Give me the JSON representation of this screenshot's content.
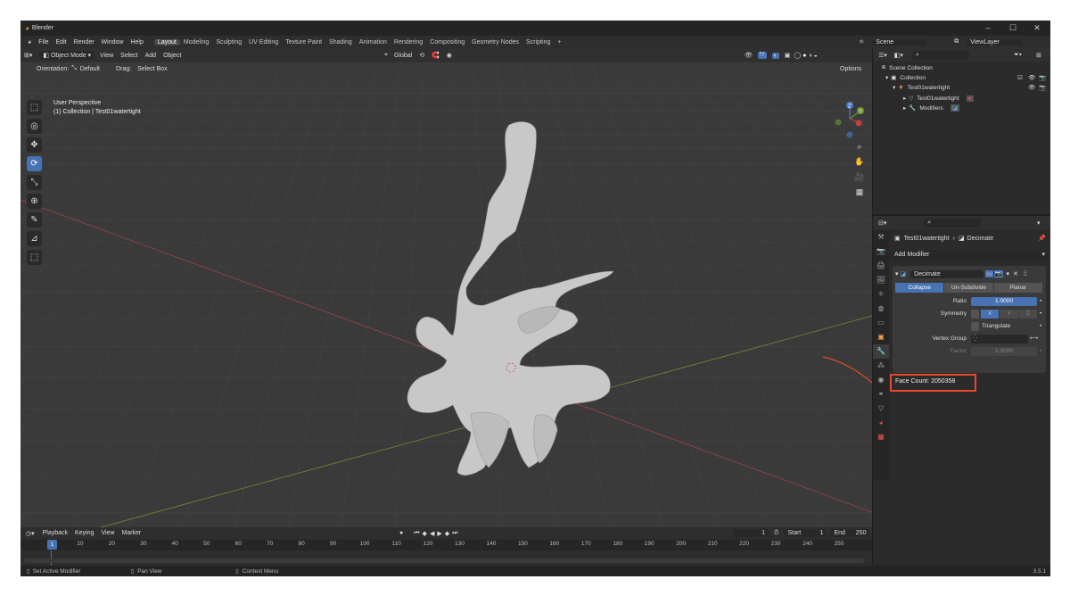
{
  "app": {
    "title": "Blender",
    "version": "3.5.1"
  },
  "menu": [
    "File",
    "Edit",
    "Render",
    "Window",
    "Help"
  ],
  "workspaces": [
    {
      "label": "Layout",
      "active": true
    },
    {
      "label": "Modeling"
    },
    {
      "label": "Sculpting"
    },
    {
      "label": "UV Editing"
    },
    {
      "label": "Texture Paint"
    },
    {
      "label": "Shading"
    },
    {
      "label": "Animation"
    },
    {
      "label": "Rendering"
    },
    {
      "label": "Compositing"
    },
    {
      "label": "Geometry Nodes"
    },
    {
      "label": "Scripting"
    }
  ],
  "add_workspace": "+",
  "scene": {
    "label": "Scene",
    "view_layer": "ViewLayer"
  },
  "viewport": {
    "mode": "Object Mode",
    "menus": [
      "View",
      "Select",
      "Add",
      "Object"
    ],
    "transform": "Global",
    "orientation_label": "Orientation:",
    "orientation_value": "Default",
    "drag_label": "Drag:",
    "drag_value": "Select Box",
    "options": "Options",
    "perspective": "User Perspective",
    "collection_info": "(1) Collection | Test01watertight",
    "colors": {
      "bg": "#3a3a3a",
      "grid": "#444444",
      "x_axis": "#b04848",
      "y_axis": "#7a9a3a",
      "mesh": "#c9c9c9"
    }
  },
  "tools": [
    {
      "icon": "select-box-icon",
      "glyph": "⬚",
      "active": false
    },
    {
      "icon": "cursor-icon",
      "glyph": "◎",
      "active": false
    },
    {
      "icon": "move-icon",
      "glyph": "✥",
      "active": false
    },
    {
      "icon": "rotate-icon",
      "glyph": "⟳",
      "active": true
    },
    {
      "icon": "scale-icon",
      "glyph": "⤡",
      "active": false
    },
    {
      "icon": "transform-icon",
      "glyph": "⊕",
      "active": false
    },
    {
      "icon": "annotate-icon",
      "glyph": "✎",
      "active": false
    },
    {
      "icon": "measure-icon",
      "glyph": "📐",
      "active": false
    },
    {
      "icon": "add-cube-icon",
      "glyph": "⬛",
      "active": false
    }
  ],
  "gizmo": {
    "z": "Z",
    "y": "Y"
  },
  "timeline": {
    "menus": [
      "Playback",
      "Keying",
      "View",
      "Marker"
    ],
    "current_frame": "1",
    "start_label": "Start",
    "start": "1",
    "end_label": "End",
    "end": "250",
    "ticks": [
      "1",
      "10",
      "20",
      "30",
      "40",
      "50",
      "60",
      "70",
      "80",
      "90",
      "100",
      "110",
      "120",
      "130",
      "140",
      "150",
      "160",
      "170",
      "180",
      "190",
      "200",
      "210",
      "220",
      "230",
      "240",
      "250"
    ]
  },
  "status": {
    "left": "Set Active Modifier",
    "middle": "Pan View",
    "right": "Context Menu"
  },
  "outliner": {
    "scene_collection": "Scene Collection",
    "collection": "Collection",
    "object": "Test01watertight",
    "mesh": "Test01watertight",
    "modifiers": "Modifiers"
  },
  "properties": {
    "object": "Test01watertight",
    "modifier_path": "Decimate",
    "add_modifier": "Add Modifier",
    "modifier_name": "Decimate",
    "modes": [
      "Collapse",
      "Un-Subdivide",
      "Planar"
    ],
    "active_mode": "Collapse",
    "ratio_label": "Ratio",
    "ratio": "1.0000",
    "symmetry_label": "Symmetry",
    "axes": [
      "X",
      "Y",
      "Z"
    ],
    "triangulate": "Triangulate",
    "vertex_group_label": "Vertex Group",
    "factor_label": "Factor",
    "factor": "1.0000",
    "face_count": "Face Count: 2050358"
  },
  "accent": {
    "blue": "#4772b3",
    "highlight": "#e8482a"
  }
}
